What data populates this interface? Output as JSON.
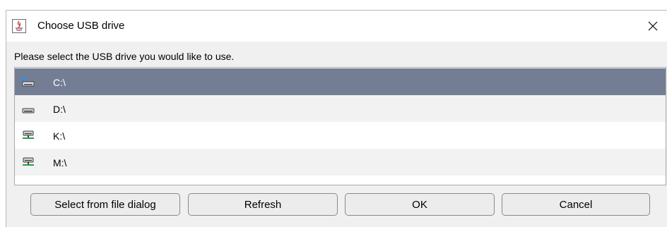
{
  "window": {
    "title": "Choose USB drive",
    "app_icon": "java-icon",
    "close_icon": "close-icon"
  },
  "prompt": "Please select the USB drive you would like to use.",
  "drives": [
    {
      "label": "C:\\",
      "icon": "system-drive-icon",
      "selected": true
    },
    {
      "label": "D:\\",
      "icon": "hard-drive-icon",
      "selected": false
    },
    {
      "label": "K:\\",
      "icon": "network-drive-icon",
      "selected": false
    },
    {
      "label": "M:\\",
      "icon": "network-drive-icon",
      "selected": false
    }
  ],
  "buttons": {
    "select_from_file_dialog": "Select from file dialog",
    "refresh": "Refresh",
    "ok": "OK",
    "cancel": "Cancel"
  },
  "colors": {
    "selection": "#737e94",
    "dialog_background": "#f0f0f0"
  }
}
